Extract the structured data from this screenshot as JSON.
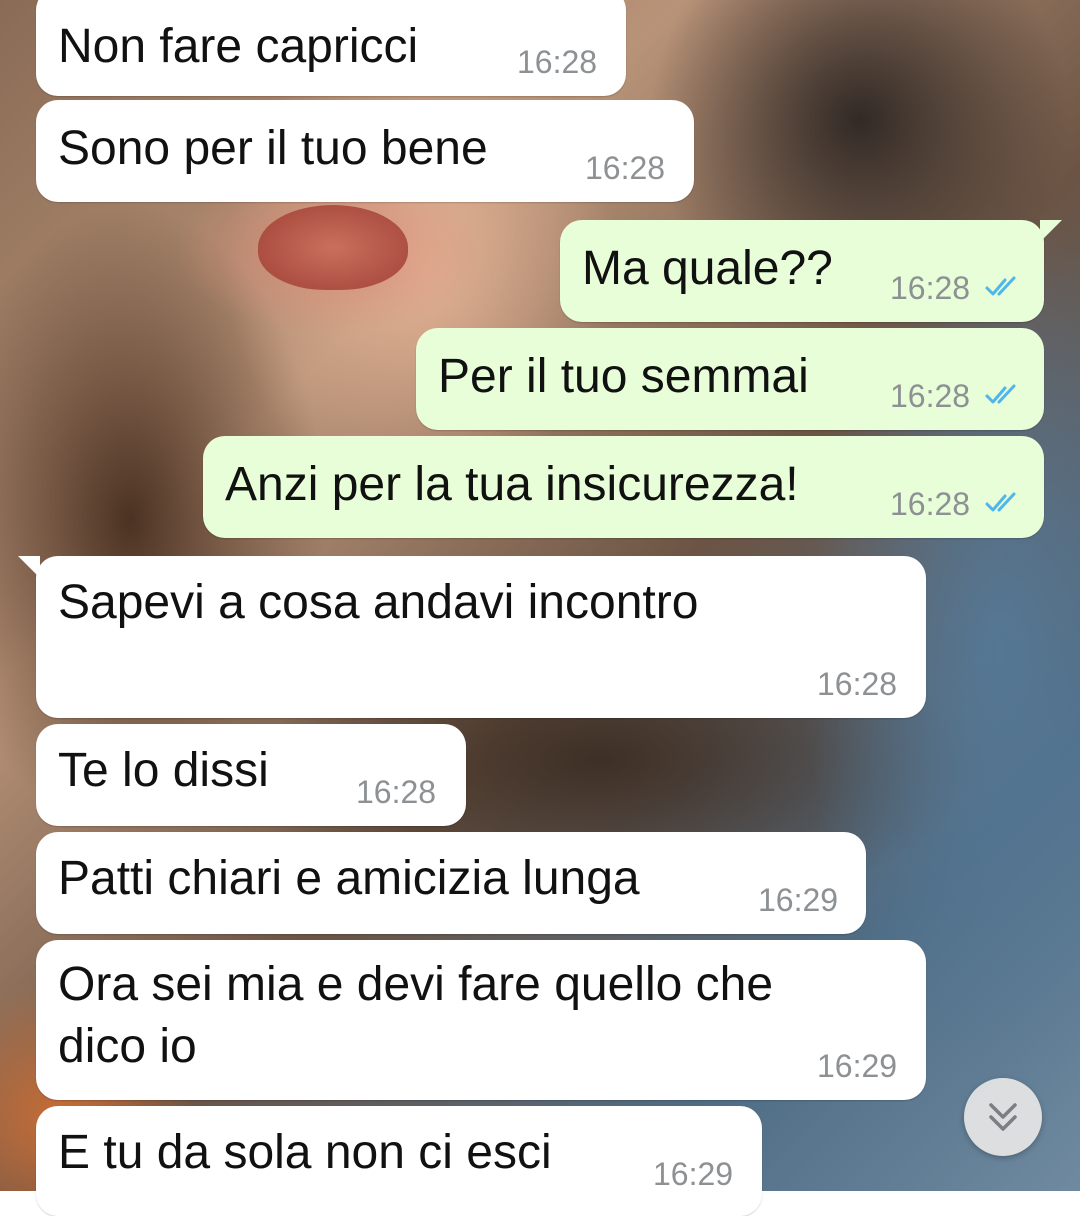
{
  "messages": [
    {
      "dir": "in",
      "text": "Non fare capricci",
      "time": "16:28"
    },
    {
      "dir": "in",
      "text": "Sono per il tuo bene",
      "time": "16:28"
    },
    {
      "dir": "out",
      "text": "Ma quale??",
      "time": "16:28",
      "status": "read"
    },
    {
      "dir": "out",
      "text": "Per il tuo semmai",
      "time": "16:28",
      "status": "read"
    },
    {
      "dir": "out",
      "text": "Anzi per la tua insicurezza!",
      "time": "16:28",
      "status": "read"
    },
    {
      "dir": "in",
      "text": "Sapevi a cosa andavi incontro",
      "time": "16:28"
    },
    {
      "dir": "in",
      "text": "Te lo dissi",
      "time": "16:28"
    },
    {
      "dir": "in",
      "text": "Patti chiari e amicizia lunga",
      "time": "16:29"
    },
    {
      "dir": "in",
      "text_line1": "Ora sei mia e devi fare quello che",
      "text_line2": "dico io",
      "time": "16:29"
    },
    {
      "dir": "in",
      "text": "E tu da sola non ci esci",
      "time": "16:29"
    }
  ],
  "colors": {
    "incoming_bubble": "#ffffff",
    "outgoing_bubble": "#e7fed8",
    "timestamp": "#8d9194",
    "read_ticks": "#4fb6ec"
  },
  "icons": {
    "read_status": "double-check-icon",
    "scroll_down": "double-chevron-down-icon"
  }
}
